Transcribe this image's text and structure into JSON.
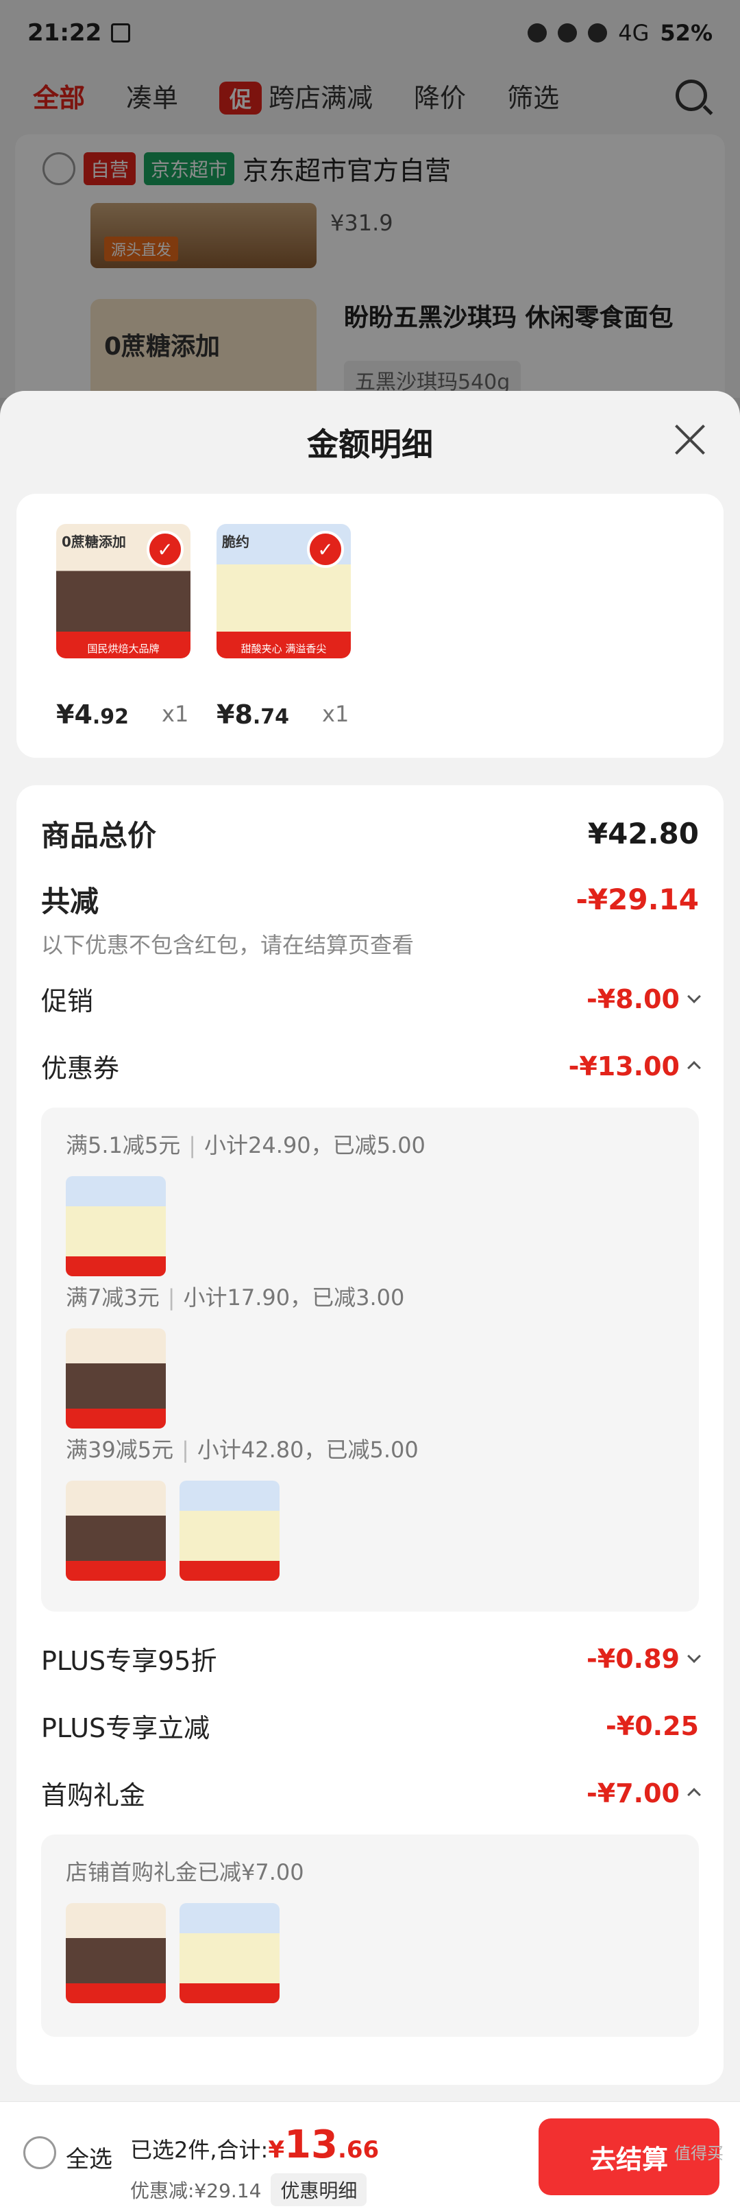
{
  "status_bar": {
    "time": "21:22",
    "battery": "52%",
    "net": "4G"
  },
  "top_nav": {
    "tabs": [
      "全部",
      "凑单"
    ],
    "cross_store_badge": "促",
    "cross_store_label": "跨店满减",
    "tabs_right": [
      "降价",
      "筛选"
    ]
  },
  "store": {
    "tag_self": "自营",
    "tag_market": "京东超市",
    "name": "京东超市官方自营",
    "prev_price": "¥31.9",
    "banner_text": "源头直发",
    "product2_title": "盼盼五黑沙琪玛 休闲零食面包",
    "product2_spec": "五黑沙琪玛540g",
    "product2_img_text": "0蔗糖添加"
  },
  "sheet": {
    "title": "金额明细",
    "items": [
      {
        "name": "sachima",
        "img_text": "0蔗糖添加",
        "img_foot": "国民烘焙大品牌",
        "price_int": "¥4",
        "price_dec": ".92",
        "qty": "x1"
      },
      {
        "name": "bread",
        "img_text": "脆约",
        "img_foot": "甜酸夹心 满溢香尖",
        "price_int": "¥8",
        "price_dec": ".74",
        "qty": "x1"
      }
    ],
    "total_label": "商品总价",
    "total_value": "¥42.80",
    "discount_label": "共减",
    "discount_value": "-¥29.14",
    "discount_note": "以下优惠不包含红包，请在结算页查看",
    "promo_label": "促销",
    "promo_value": "-¥8.00",
    "coupon_label": "优惠券",
    "coupon_value": "-¥13.00",
    "coupon_rules": [
      {
        "rule": "满5.1减5元",
        "detail": "小计24.90，已减5.00"
      },
      {
        "rule": "满7减3元",
        "detail": "小计17.90，已减3.00"
      },
      {
        "rule": "满39减5元",
        "detail": "小计42.80，已减5.00"
      }
    ],
    "plus95_label": "PLUS专享95折",
    "plus95_value": "-¥0.89",
    "plus_cut_label": "PLUS专享立减",
    "plus_cut_value": "-¥0.25",
    "first_gift_label": "首购礼金",
    "first_gift_value": "-¥7.00",
    "first_gift_note": "店铺首购礼金已减¥7.00"
  },
  "bottom_bar": {
    "select_all": "全选",
    "selected_text": "已选2件,合计:",
    "currency": "¥",
    "total_int": "13",
    "total_dec": ".66",
    "discount_text": "优惠减:¥29.14",
    "detail_button": "优惠明细",
    "checkout_button": "去结算"
  },
  "watermark": "值得买",
  "colors": {
    "accent": "#e2231a",
    "checkout": "#f23030"
  }
}
